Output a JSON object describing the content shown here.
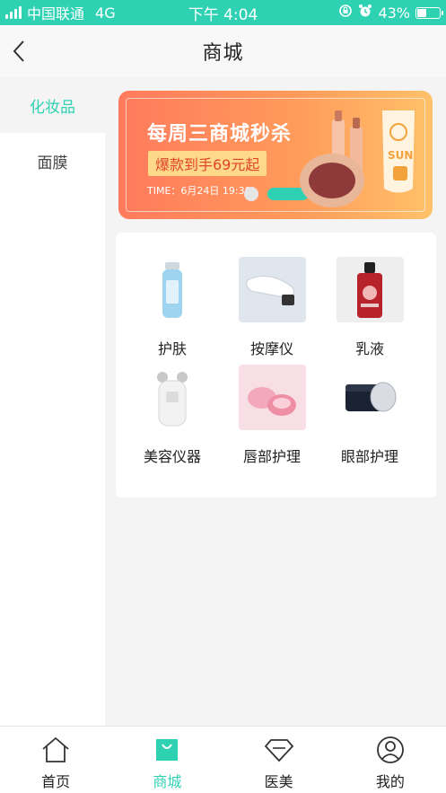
{
  "status_bar": {
    "carrier": "中国联通",
    "network": "4G",
    "time": "下午 4:04",
    "battery_percent": "43%",
    "battery_level": 0.43
  },
  "nav": {
    "title": "商城"
  },
  "sidebar": {
    "items": [
      {
        "label": "化妆品",
        "active": true
      },
      {
        "label": "面膜",
        "active": false
      }
    ]
  },
  "banner": {
    "title": "每周三商城秒杀",
    "subtitle": "爆款到手69元起",
    "time": "TIME：6月24日 19:30",
    "slide_count": 2,
    "active_slide": 2
  },
  "categories": [
    {
      "label": "护肤",
      "icon": "serum-bottle-icon"
    },
    {
      "label": "按摩仪",
      "icon": "massager-icon"
    },
    {
      "label": "乳液",
      "icon": "lotion-bottle-icon"
    },
    {
      "label": "美容仪器",
      "icon": "beauty-device-icon"
    },
    {
      "label": "唇部护理",
      "icon": "lip-balm-icon"
    },
    {
      "label": "眼部护理",
      "icon": "eye-cream-jar-icon"
    }
  ],
  "tab_bar": {
    "tabs": [
      {
        "label": "首页",
        "icon": "home-icon",
        "active": false
      },
      {
        "label": "商城",
        "icon": "shopping-bag-icon",
        "active": true
      },
      {
        "label": "医美",
        "icon": "diamond-icon",
        "active": false
      },
      {
        "label": "我的",
        "icon": "user-icon",
        "active": false
      }
    ]
  },
  "colors": {
    "accent": "#2fd1b3",
    "banner_start": "#ff7a5c",
    "banner_end": "#ffc16a",
    "text_primary": "#222222"
  }
}
